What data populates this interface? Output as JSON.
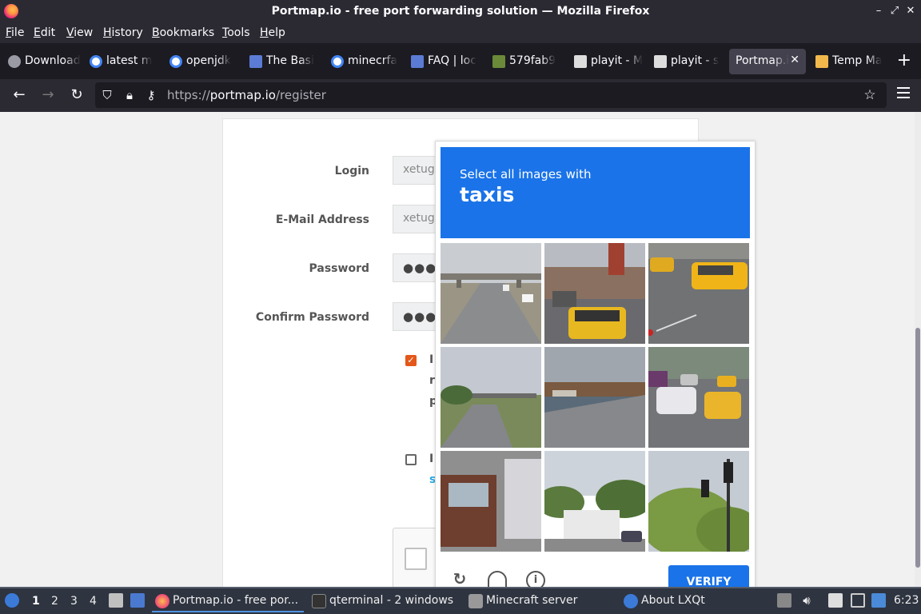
{
  "window": {
    "title": "Portmap.io - free port forwarding solution — Mozilla Firefox"
  },
  "menu": [
    "File",
    "Edit",
    "View",
    "History",
    "Bookmarks",
    "Tools",
    "Help"
  ],
  "tabs": [
    {
      "label": "Download",
      "icon": "download-icon"
    },
    {
      "label": "latest m",
      "icon": "google-icon"
    },
    {
      "label": "openjdk",
      "icon": "google-icon"
    },
    {
      "label": "The Basi",
      "icon": "page-icon"
    },
    {
      "label": "minecrfa",
      "icon": "google-icon"
    },
    {
      "label": "FAQ | loc",
      "icon": "page-icon"
    },
    {
      "label": "579fab9",
      "icon": "minecraft-icon"
    },
    {
      "label": "playit - M",
      "icon": "playit-icon"
    },
    {
      "label": "playit - s",
      "icon": "playit-icon"
    },
    {
      "label": "Portmap.i",
      "icon": "portmap-icon",
      "active": true
    },
    {
      "label": "Temp Ma",
      "icon": "mail-icon"
    }
  ],
  "address": {
    "prefix": "https://",
    "host": "portmap.io",
    "path": "/register"
  },
  "form": {
    "login_label": "Login",
    "login_value": "xetugi",
    "email_label": "E-Mail Address",
    "email_value": "xetugi",
    "password_label": "Password",
    "password_value": "●●●",
    "confirm_label": "Confirm Password",
    "confirm_value": "●●●",
    "terms_line1": "I",
    "terms_line2": "r",
    "terms_line3": "p",
    "newsletter_line1": "I",
    "newsletter_link": "s"
  },
  "captcha": {
    "prompt_small": "Select all images with",
    "prompt_big": "taxis",
    "verify_label": "VERIFY",
    "tiles": [
      {
        "name": "highway-overpass",
        "has_taxi": false
      },
      {
        "name": "street-taxi-front",
        "has_taxi": true
      },
      {
        "name": "taxi-on-road",
        "has_taxi": true
      },
      {
        "name": "overpass-road",
        "has_taxi": false
      },
      {
        "name": "harbor-road",
        "has_taxi": false
      },
      {
        "name": "traffic-taxis",
        "has_taxi": true
      },
      {
        "name": "truck-street",
        "has_taxi": false
      },
      {
        "name": "building-trees",
        "has_taxi": false
      },
      {
        "name": "traffic-lights-trees",
        "has_taxi": false
      }
    ]
  },
  "taskbar": {
    "workspaces": [
      "1",
      "2",
      "3",
      "4"
    ],
    "tasks": [
      "Portmap.io - free por...",
      "qterminal - 2 windows",
      "Minecraft server",
      "About LXQt"
    ],
    "clock": "6:23"
  },
  "colors": {
    "accent": "#1a73e8",
    "checkbox_checked": "#e3581a",
    "browser_chrome": "#2b2a33"
  }
}
